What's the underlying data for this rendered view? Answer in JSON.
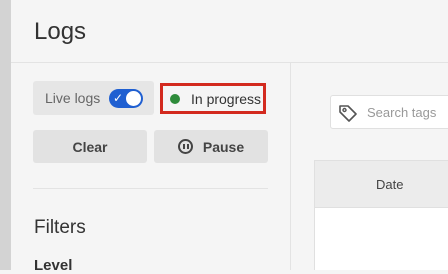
{
  "page": {
    "title": "Logs"
  },
  "controls": {
    "live_logs_label": "Live logs",
    "live_logs_on": true,
    "status_text": "In progress",
    "clear_label": "Clear",
    "pause_label": "Pause"
  },
  "filters": {
    "title": "Filters",
    "level_label": "Level"
  },
  "search": {
    "placeholder": "Search tags"
  },
  "table": {
    "columns": [
      "Date"
    ]
  },
  "colors": {
    "toggle_on": "#1f5fd1",
    "status_green": "#2e8b3a",
    "highlight_red": "#d32a1f"
  }
}
